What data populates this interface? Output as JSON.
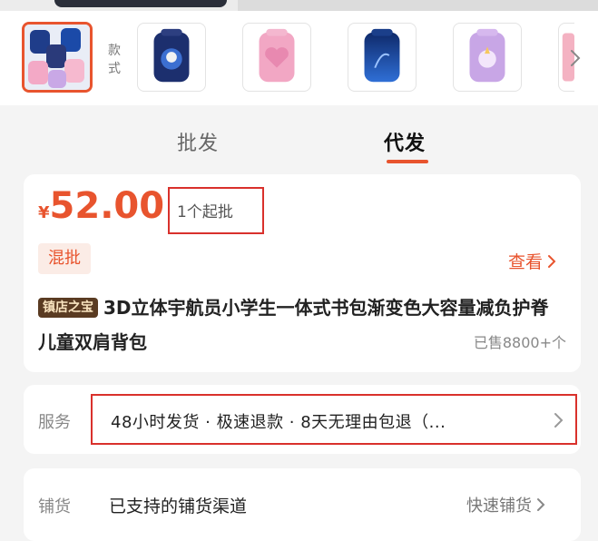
{
  "variants": {
    "label": "款式",
    "thumbnails": [
      {
        "name": "variant-main",
        "selected": true,
        "color": "#1f3d8a"
      },
      {
        "name": "variant-astronaut-navy",
        "selected": false,
        "color": "#1c2f6e"
      },
      {
        "name": "variant-heart-pink",
        "selected": false,
        "color": "#f2a7c4"
      },
      {
        "name": "variant-blue-gradient",
        "selected": false,
        "color": "#1b4aa8"
      },
      {
        "name": "variant-unicorn-purple",
        "selected": false,
        "color": "#c8a6e6"
      },
      {
        "name": "variant-bear-pink",
        "selected": false,
        "color": "#f4b2c2"
      }
    ]
  },
  "tabs": {
    "wholesale": "批发",
    "dropship": "代发",
    "active": "dropship"
  },
  "price": {
    "currency": "¥",
    "amount": "52.00",
    "min_order": "1个起批"
  },
  "mix_badge": "混批",
  "view_link": "查看",
  "product": {
    "store_badge": "镇店之宝",
    "title": "3D立体宇航员小学生一体式书包渐变色大容量减负护脊儿童双肩背包",
    "sold": "已售8800+个"
  },
  "service": {
    "label": "服务",
    "text": "48小时发货 · 极速退款 · 8天无理由包退（..."
  },
  "distribution": {
    "label": "铺货",
    "text": "已支持的铺货渠道",
    "link": "快速铺货"
  },
  "colors": {
    "accent": "#e8542e",
    "highlight_box": "#d9312c",
    "badge_bg": "#5a3b22"
  }
}
